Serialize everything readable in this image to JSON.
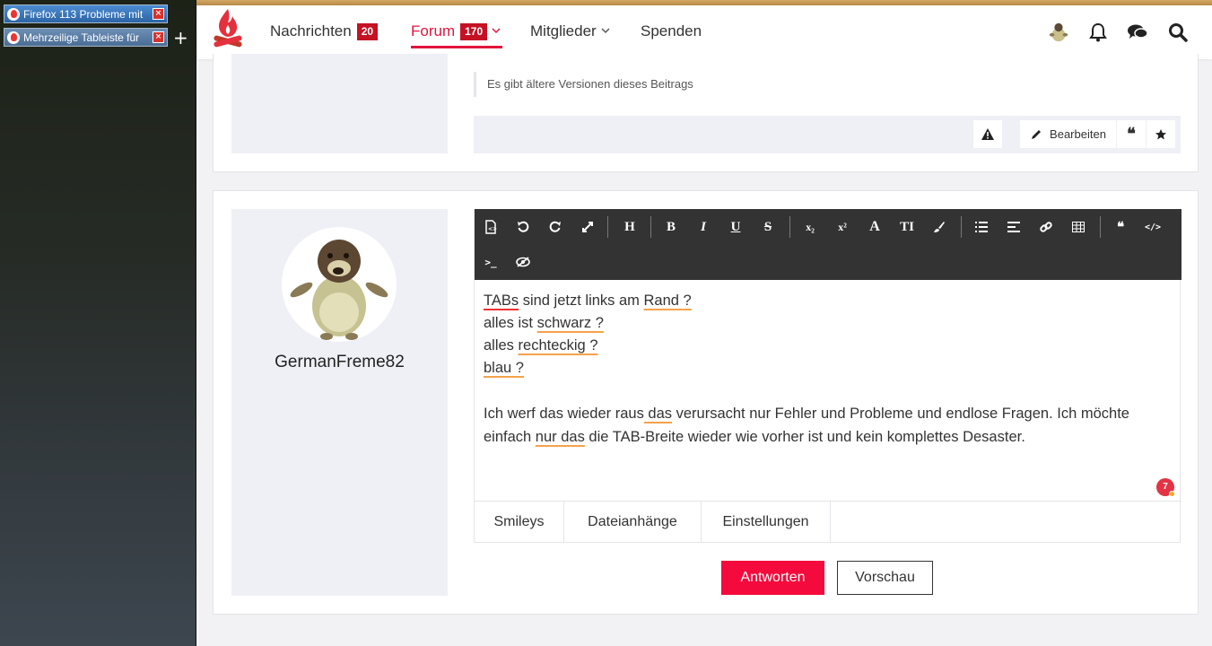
{
  "browser": {
    "tabs": [
      {
        "title": "Firefox 113 Probleme mit",
        "close": "×"
      },
      {
        "title": "Mehrzeilige Tableiste für",
        "close": "×"
      }
    ],
    "new_tab_label": "+"
  },
  "header": {
    "nav": [
      {
        "label": "Nachrichten",
        "badge": "20"
      },
      {
        "label": "Forum",
        "badge": "170",
        "chevron": "⌄"
      },
      {
        "label": "Mitglieder",
        "chevron": "⌄"
      },
      {
        "label": "Spenden"
      }
    ],
    "active_color": "#e3153d"
  },
  "post": {
    "older_versions_note": "Es gibt ältere Versionen dieses Beitrags",
    "edit_label": "Bearbeiten"
  },
  "reply": {
    "username": "GermanFreme82",
    "text_lines": [
      {
        "segments": [
          {
            "t": "TABs",
            "u": "red"
          },
          {
            "t": " sind jetzt links am "
          },
          {
            "t": "Rand ?",
            "u": "orange"
          }
        ]
      },
      {
        "segments": [
          {
            "t": "alles ist "
          },
          {
            "t": "schwarz ?",
            "u": "orange"
          }
        ]
      },
      {
        "segments": [
          {
            "t": "alles "
          },
          {
            "t": "rechteckig ?",
            "u": "orange"
          }
        ]
      },
      {
        "segments": [
          {
            "t": "blau ?",
            "u": "orange"
          }
        ]
      }
    ],
    "paragraph_segments": [
      {
        "t": "Ich werf das wieder raus"
      },
      {
        "t": " das",
        "u": "orange"
      },
      {
        "t": " verursacht nur Fehler und Probleme und endlose Fragen. Ich möchte einfach "
      },
      {
        "t": "nur das",
        "u": "orange"
      },
      {
        "t": " die TAB-Breite wieder wie vorher ist und kein komplettes Desaster."
      }
    ],
    "grammar_count": "7",
    "editor_tabs": [
      "Smileys",
      "Dateianhänge",
      "Einstellungen"
    ],
    "reply_button": "Antworten",
    "preview_button": "Vorschau"
  },
  "toolbar_icons": [
    "source-icon",
    "undo-icon",
    "redo-icon",
    "fullscreen-icon",
    "heading-icon",
    "bold-icon",
    "italic-icon",
    "underline-icon",
    "strikethrough-icon",
    "subscript-icon",
    "superscript-icon",
    "font-icon",
    "font-size-icon",
    "color-icon",
    "list-icon",
    "align-icon",
    "link-icon",
    "table-icon",
    "quote-icon",
    "code-icon",
    "terminal-icon",
    "spoiler-icon"
  ],
  "toolbar_text": {
    "heading": "H",
    "bold": "B",
    "italic": "I",
    "underline": "U",
    "strike": "S",
    "sub": "x₂",
    "sup": "x²",
    "font": "A",
    "size": "TI",
    "quote": "❝",
    "code": "</>",
    "terminal": ">_"
  }
}
